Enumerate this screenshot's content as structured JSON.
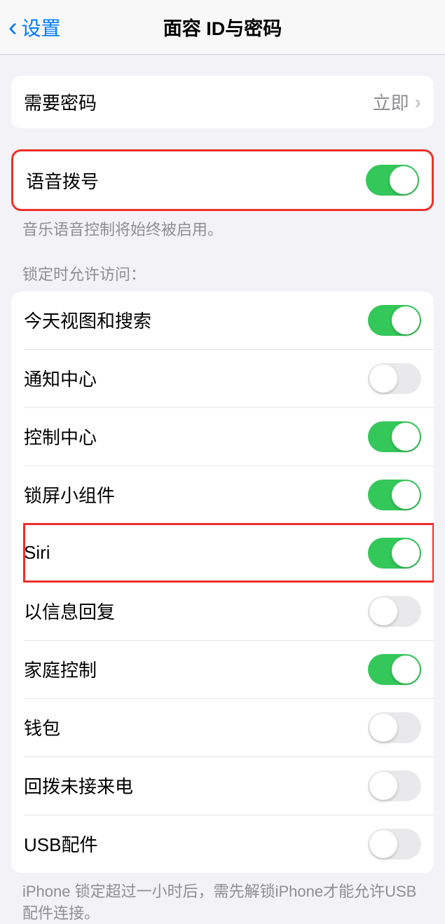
{
  "header": {
    "back_label": "设置",
    "title": "面容 ID与密码"
  },
  "passcode_group": {
    "require_passcode_label": "需要密码",
    "require_passcode_value": "立即"
  },
  "voice_dial": {
    "label": "语音拨号",
    "enabled": true,
    "footer": "音乐语音控制将始终被启用。"
  },
  "locked_access": {
    "header": "锁定时允许访问：",
    "items": [
      {
        "label": "今天视图和搜索",
        "enabled": true
      },
      {
        "label": "通知中心",
        "enabled": false
      },
      {
        "label": "控制中心",
        "enabled": true
      },
      {
        "label": "锁屏小组件",
        "enabled": true
      },
      {
        "label": "Siri",
        "enabled": true
      },
      {
        "label": "以信息回复",
        "enabled": false
      },
      {
        "label": "家庭控制",
        "enabled": true
      },
      {
        "label": "钱包",
        "enabled": false
      },
      {
        "label": "回拨未接来电",
        "enabled": false
      },
      {
        "label": "USB配件",
        "enabled": false
      }
    ],
    "footer": "iPhone 锁定超过一小时后，需先解锁iPhone才能允许USB 配件连接。"
  }
}
